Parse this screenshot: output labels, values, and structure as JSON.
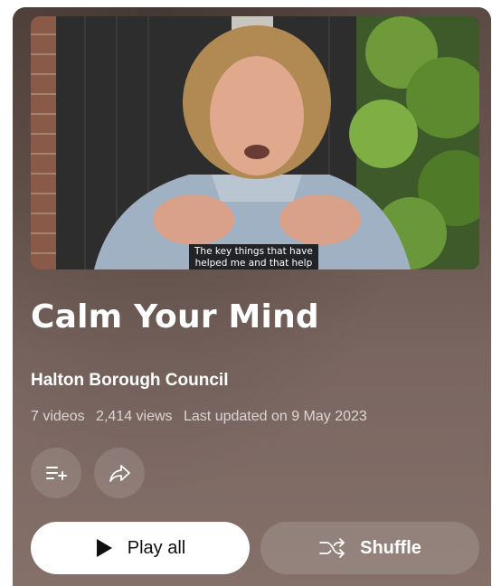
{
  "playlist": {
    "title": "Calm Your Mind",
    "owner": "Halton Borough Council",
    "video_count": "7 videos",
    "views": "2,414 views",
    "last_updated": "Last updated on 9 May 2023"
  },
  "thumbnail": {
    "caption": "The key things that have\nhelped me and that help"
  },
  "actions": {
    "save_icon": "playlist-add-icon",
    "share_icon": "share-icon",
    "play_all_label": "Play all",
    "shuffle_label": "Shuffle"
  },
  "colors": {
    "card_background": "#6b5751",
    "play_button": "#ffffff",
    "text_primary": "#ffffff"
  }
}
